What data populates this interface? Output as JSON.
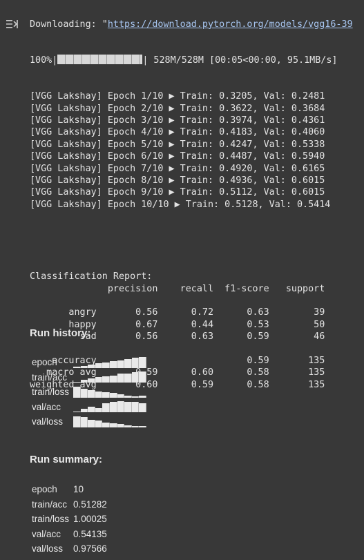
{
  "console": {
    "download_prefix": "Downloading: \"",
    "download_url": "https://download.pytorch.org/models/vgg16-39",
    "progress_pct": "100%|",
    "progress_tail": "| 528M/528M [00:05<00:00, 95.1MB/s]",
    "epochs": [
      "[VGG Lakshay] Epoch 1/10 ▶ Train: 0.3205, Val: 0.2481",
      "[VGG Lakshay] Epoch 2/10 ▶ Train: 0.3622, Val: 0.3684",
      "[VGG Lakshay] Epoch 3/10 ▶ Train: 0.3974, Val: 0.4361",
      "[VGG Lakshay] Epoch 4/10 ▶ Train: 0.4183, Val: 0.4060",
      "[VGG Lakshay] Epoch 5/10 ▶ Train: 0.4247, Val: 0.5338",
      "[VGG Lakshay] Epoch 6/10 ▶ Train: 0.4487, Val: 0.5940",
      "[VGG Lakshay] Epoch 7/10 ▶ Train: 0.4920, Val: 0.6165",
      "[VGG Lakshay] Epoch 8/10 ▶ Train: 0.4936, Val: 0.6015",
      "[VGG Lakshay] Epoch 9/10 ▶ Train: 0.5112, Val: 0.6015",
      "[VGG Lakshay] Epoch 10/10 ▶ Train: 0.5128, Val: 0.5414"
    ],
    "report_lines": [
      "Classification Report:",
      "              precision    recall  f1-score   support",
      "",
      "       angry       0.56      0.72      0.63        39",
      "       happy       0.67      0.44      0.53        50",
      "         sad       0.56      0.63      0.59        46",
      "",
      "    accuracy                           0.59       135",
      "   macro avg       0.59      0.60      0.58       135",
      "weighted avg       0.60      0.59      0.58       135"
    ]
  },
  "run_history": {
    "title": "Run history:",
    "rows": [
      {
        "key": "epoch",
        "levels": [
          0.1,
          0.2,
          0.3,
          0.4,
          0.5,
          0.6,
          0.7,
          0.8,
          0.9,
          1.0
        ]
      },
      {
        "key": "train/acc",
        "levels": [
          0.1,
          0.25,
          0.4,
          0.5,
          0.55,
          0.65,
          0.85,
          0.86,
          0.98,
          1.0
        ]
      },
      {
        "key": "train/loss",
        "levels": [
          1.0,
          0.8,
          0.65,
          0.55,
          0.5,
          0.42,
          0.3,
          0.2,
          0.1,
          0.15
        ]
      },
      {
        "key": "val/acc",
        "levels": [
          0.1,
          0.3,
          0.5,
          0.42,
          0.8,
          0.95,
          1.0,
          0.97,
          0.97,
          0.8
        ]
      },
      {
        "key": "val/loss",
        "levels": [
          1.0,
          0.9,
          0.7,
          0.6,
          0.4,
          0.35,
          0.3,
          0.15,
          0.1,
          0.12
        ]
      }
    ]
  },
  "run_summary": {
    "title": "Run summary:",
    "rows": [
      {
        "key": "epoch",
        "value": "10"
      },
      {
        "key": "train/acc",
        "value": "0.51282"
      },
      {
        "key": "train/loss",
        "value": "1.00025"
      },
      {
        "key": "val/acc",
        "value": "0.54135"
      },
      {
        "key": "val/loss",
        "value": "0.97566"
      }
    ]
  },
  "colors": {
    "background": "#383838",
    "text": "#e3e3e3",
    "link": "#a7c5f0"
  }
}
